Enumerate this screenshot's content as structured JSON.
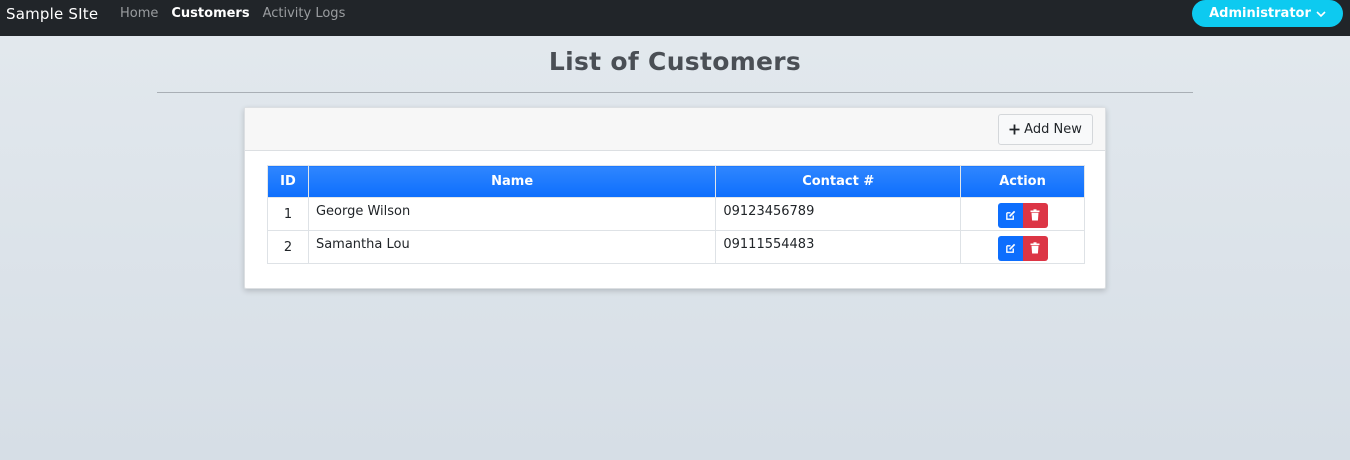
{
  "nav": {
    "brand": "Sample SIte",
    "links": [
      {
        "label": "Home",
        "active": false
      },
      {
        "label": "Customers",
        "active": true
      },
      {
        "label": "Activity Logs",
        "active": false
      }
    ],
    "user_button": "Administrator"
  },
  "page": {
    "title": "List of Customers"
  },
  "card": {
    "add_button": "Add New"
  },
  "table": {
    "headers": [
      "ID",
      "Name",
      "Contact #",
      "Action"
    ],
    "rows": [
      {
        "id": "1",
        "name": "George Wilson",
        "contact": "09123456789"
      },
      {
        "id": "2",
        "name": "Samantha Lou",
        "contact": "09111554483"
      }
    ]
  },
  "icons": {
    "add": "plus-icon",
    "edit": "edit-icon",
    "delete": "trash-icon",
    "user_menu": "chevron-down-icon"
  },
  "colors": {
    "navbar": "#212529",
    "user_button": "#0dcaf0",
    "table_header": "#0d6efd",
    "edit_button": "#0d6efd",
    "delete_button": "#dc3545"
  }
}
